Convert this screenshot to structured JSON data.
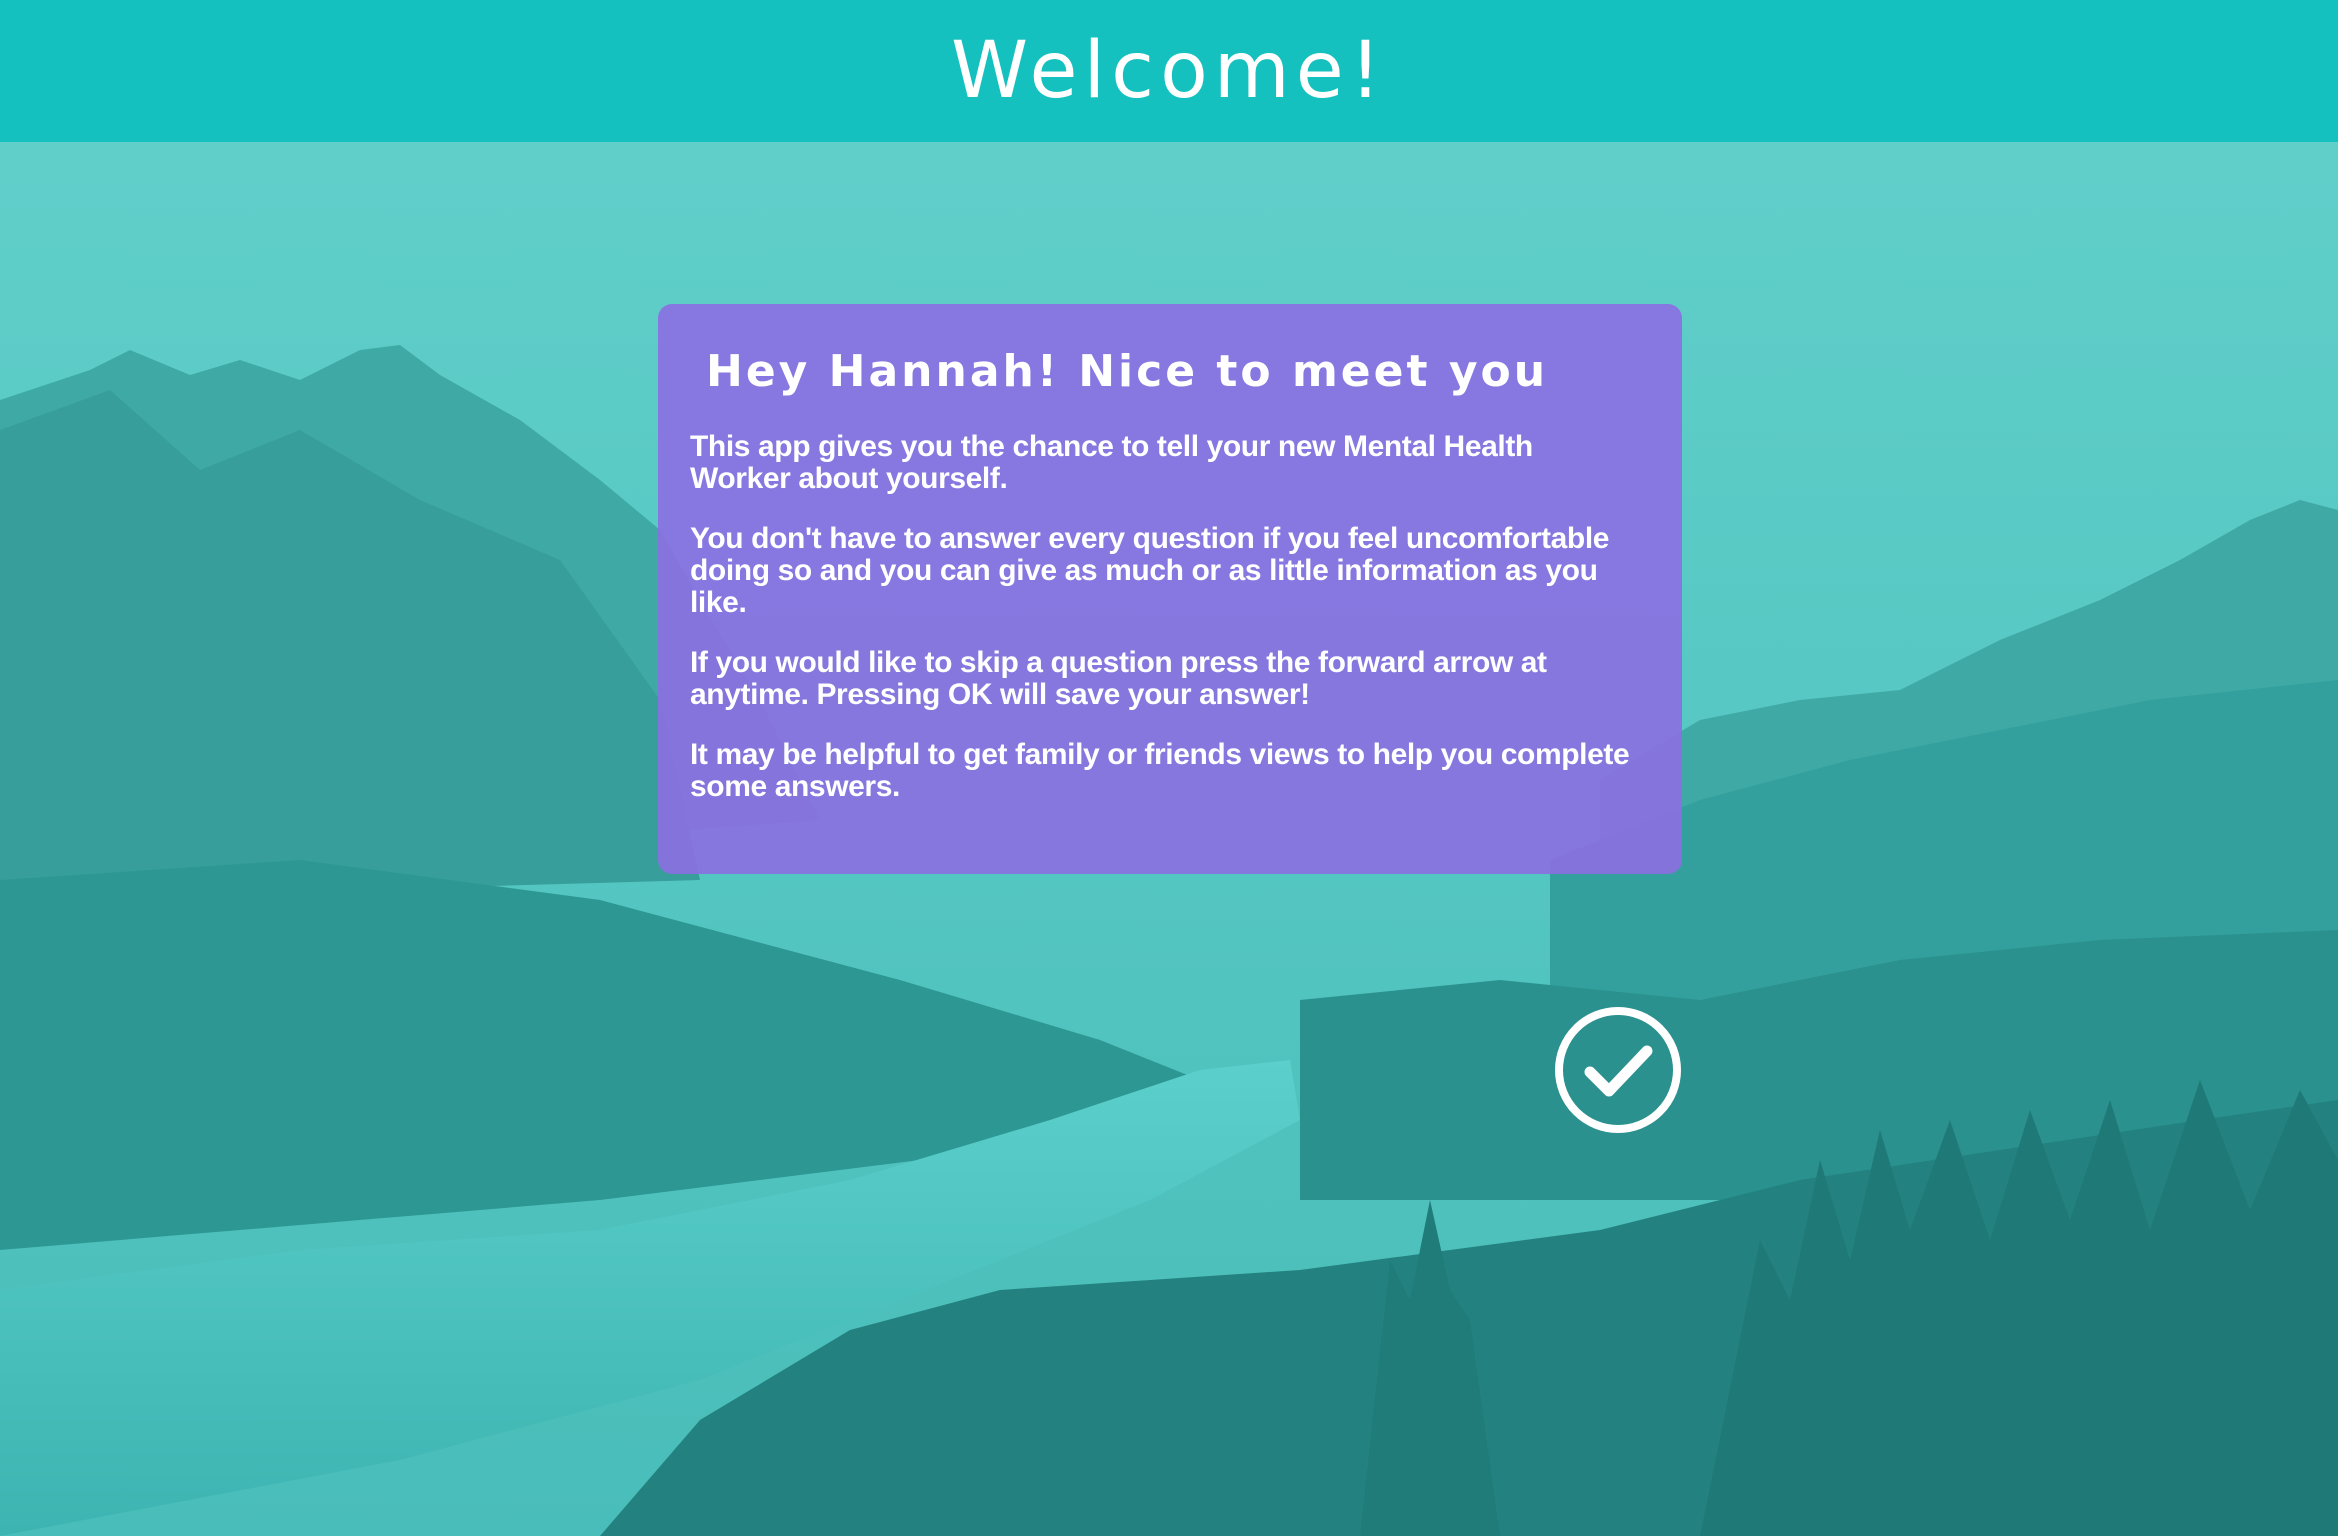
{
  "header": {
    "title": "Welcome!"
  },
  "card": {
    "heading": "Hey Hannah! Nice to meet you",
    "paragraphs": [
      "This app gives you the chance to tell your new Mental Health Worker about yourself.",
      "You don't have to answer every question if you feel uncomfortable doing so and you can give as much or as little information as you like.",
      "If you would like to skip a question press the forward arrow at anytime. Pressing OK will save your answer!",
      "It may be helpful to get family or friends views to help you complete some answers."
    ]
  },
  "confirm": {
    "icon": "check-circle-icon"
  },
  "colors": {
    "header": "#14c1bf",
    "card": "#8c6ee2",
    "text": "#ffffff",
    "background_tint": "#2aa9a6"
  }
}
